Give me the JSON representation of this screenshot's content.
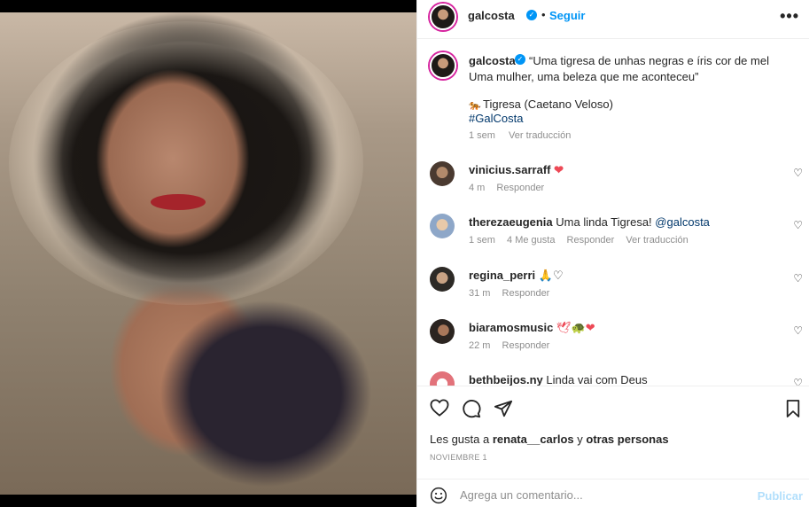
{
  "post": {
    "username": "galcosta",
    "follow_label": "Seguir",
    "dot": "•",
    "more": "•••"
  },
  "caption": {
    "username": "galcosta",
    "line1": "“Uma tigresa de unhas negras e íris cor de mel",
    "line2": "Uma mulher, uma beleza que me aconteceu”",
    "song": "Tigresa (Caetano Veloso)",
    "hashtag": "#GalCosta",
    "time": "1 sem",
    "translate": "Ver traducción"
  },
  "comments": [
    {
      "username": "vinicius.sarraff",
      "text": "",
      "emoji": "❤",
      "time": "4 m",
      "likes": "",
      "reply": "Responder",
      "translate": ""
    },
    {
      "username": "therezaeugenia",
      "text": "Uma linda Tigresa!",
      "mention": "@galcosta",
      "time": "1 sem",
      "likes": "4 Me gusta",
      "reply": "Responder",
      "translate": "Ver traducción"
    },
    {
      "username": "regina_perri",
      "text": "",
      "emoji": "🙏♡",
      "time": "31 m",
      "likes": "",
      "reply": "Responder",
      "translate": ""
    },
    {
      "username": "biaramosmusic",
      "text": "",
      "emoji": "🕊🐢❤",
      "time": "22 m",
      "likes": "",
      "reply": "Responder",
      "translate": ""
    },
    {
      "username": "bethbeijos.ny",
      "text": "Linda vai com Deus",
      "time": "",
      "likes": "",
      "reply": "",
      "translate": ""
    }
  ],
  "likes": {
    "prefix": "Les gusta a",
    "user": "renata__carlos",
    "connector": "y",
    "others": "otras personas"
  },
  "date": "NOVIEMBRE 1",
  "add_comment": {
    "placeholder": "Agrega un comentario...",
    "publish": "Publicar"
  },
  "colors": {
    "accent": "#0095f6",
    "heart": "#ed4956",
    "link": "#00376b",
    "muted": "#8e8e8e",
    "publish_disabled": "#b2dffc"
  },
  "icons": [
    "verified-icon",
    "more-options-icon",
    "heart-icon",
    "comment-icon",
    "share-icon",
    "bookmark-icon",
    "emoji-icon"
  ]
}
